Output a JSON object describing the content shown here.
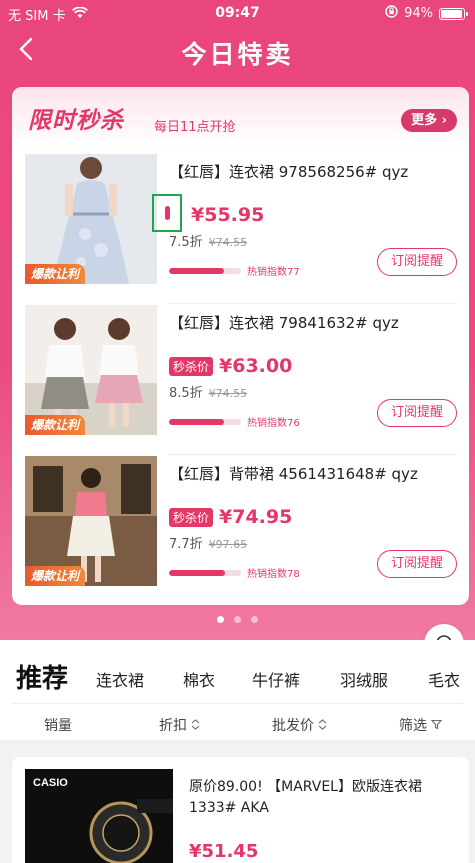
{
  "status_bar": {
    "carrier": "无 SIM 卡",
    "time": "09:47",
    "battery": "94%",
    "battery_level": 0.94
  },
  "nav": {
    "title": "今日特卖",
    "back_icon": "chevron-left-icon"
  },
  "flash_sale": {
    "title": "限时秒杀",
    "subtitle": "每日11点开抢",
    "more": "更多",
    "items": [
      {
        "title": "【红唇】连衣裙 978568256# qyz",
        "tag": "",
        "price": "¥55.95",
        "discount": "7.5折",
        "original": "¥74.55",
        "hot_label": "热销指数77",
        "hot_level": 0.77,
        "badge": "爆款让利",
        "subscribe": "订阅提醒"
      },
      {
        "title": "【红唇】连衣裙 79841632# qyz",
        "tag": "秒杀价",
        "price": "¥63.00",
        "discount": "8.5折",
        "original": "¥74.55",
        "hot_label": "热销指数76",
        "hot_level": 0.76,
        "badge": "爆款让利",
        "subscribe": "订阅提醒"
      },
      {
        "title": "【红唇】背带裙 4561431648# qyz",
        "tag": "秒杀价",
        "price": "¥74.95",
        "discount": "7.7折",
        "original": "¥97.65",
        "hot_label": "热销指数78",
        "hot_level": 0.78,
        "badge": "爆款让利",
        "subscribe": "订阅提醒"
      }
    ],
    "page_count": 3,
    "active_page": 1
  },
  "recommend": {
    "title": "推荐",
    "categories": [
      "连衣裙",
      "棉衣",
      "牛仔裤",
      "羽绒服",
      "毛衣"
    ],
    "filters": [
      "销量",
      "折扣",
      "批发价",
      "筛选"
    ]
  },
  "product": {
    "brand": "CASIO",
    "title": "原价89.00! 【MARVEL】欧版连衣裙1333# AKA",
    "price": "¥51.45"
  },
  "colors": {
    "accent": "#e33867",
    "hero_top": "#e9467e",
    "hero_bottom": "#f07aa0"
  }
}
